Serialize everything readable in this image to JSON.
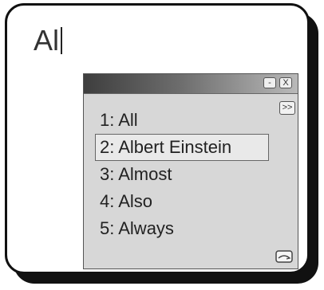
{
  "editor": {
    "typed_text": "Al"
  },
  "ime_window": {
    "minimize_label": "-",
    "close_label": "X",
    "expand_label": ">>",
    "candidates": [
      "1: All",
      "2: Albert Einstein",
      "3: Almost",
      "4: Also",
      "5: Always"
    ],
    "selected_index": 1,
    "footer_icon": "keyboard-toggle-icon"
  }
}
